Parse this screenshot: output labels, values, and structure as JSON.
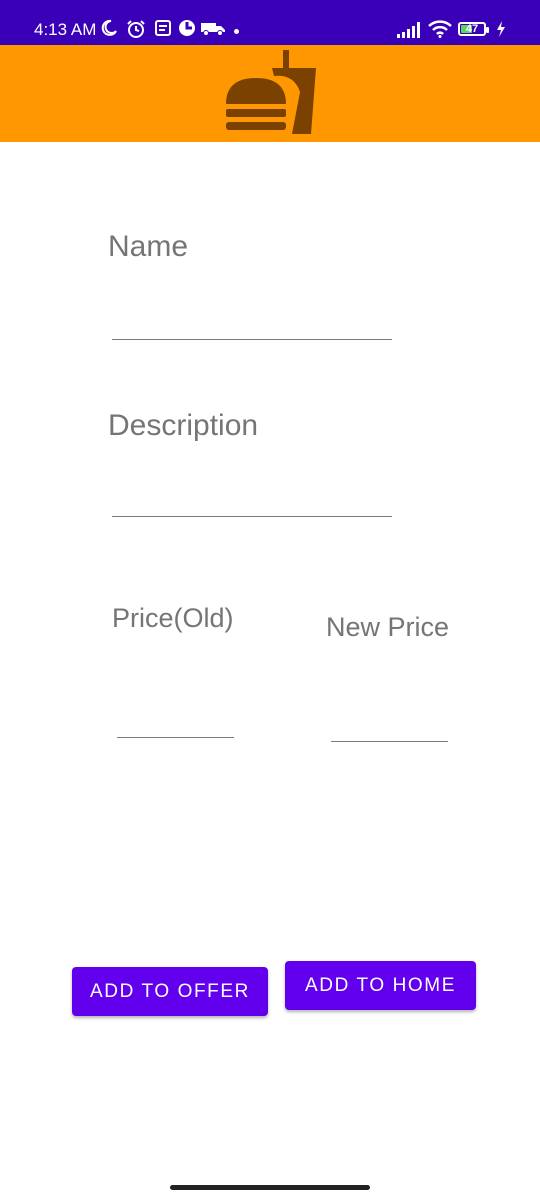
{
  "status_bar": {
    "time": "4:13 AM",
    "battery_level": "47",
    "icons": [
      "moon-icon",
      "alarm-icon",
      "notes-icon",
      "app-icon",
      "truck-icon",
      "signal-icon",
      "wifi-icon",
      "battery-icon",
      "charging-icon"
    ]
  },
  "app_bar": {
    "logo": "fast-food-logo",
    "color": "#ff9800",
    "logo_color": "#7a4100"
  },
  "form": {
    "name_label": "Name",
    "description_label": "Description",
    "old_price_label": "Price(Old)",
    "new_price_label": "New Price"
  },
  "actions": {
    "add_to_offer": "ADD TO OFFER",
    "add_to_home": "ADD TO HOME",
    "button_color": "#6200ee"
  }
}
